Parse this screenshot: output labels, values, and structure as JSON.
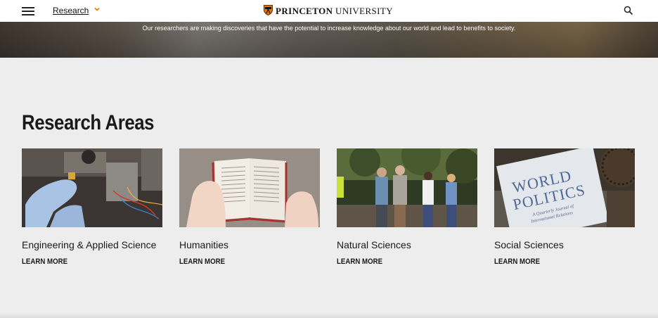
{
  "header": {
    "section_label": "Research",
    "brand_bold": "PRINCETON",
    "brand_light": " UNIVERSITY",
    "menu_icon": "hamburger-icon",
    "search_icon": "search-icon",
    "accent_color": "#e77500"
  },
  "hero": {
    "tagline": "Our researchers are making discoveries that have the potential to increase knowledge about our world and lead to benefits to society."
  },
  "research_areas": {
    "title": "Research Areas",
    "cards": [
      {
        "title": "Engineering & Applied Science",
        "link": "LEARN MORE"
      },
      {
        "title": "Humanities",
        "link": "LEARN MORE"
      },
      {
        "title": "Natural Sciences",
        "link": "LEARN MORE"
      },
      {
        "title": "Social Sciences",
        "link": "LEARN MORE"
      }
    ],
    "book_cover": {
      "title_line1": "WORLD",
      "title_line2": "POLITICS",
      "subtitle1": "A Quarterly Journal of",
      "subtitle2": "International Relations"
    }
  }
}
